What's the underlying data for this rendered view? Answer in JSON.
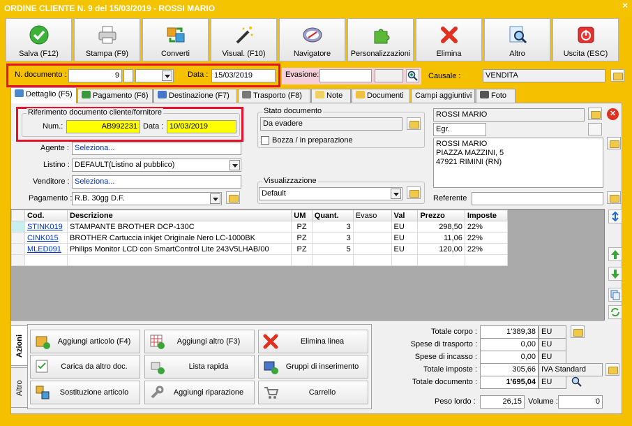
{
  "window": {
    "title": "ORDINE CLIENTE N. 9 del 15/03/2019 - ROSSI MARIO",
    "close": "×"
  },
  "toolbar": [
    {
      "label": "Salva (F12)",
      "icon": "check-icon"
    },
    {
      "label": "Stampa (F9)",
      "icon": "printer-icon"
    },
    {
      "label": "Converti",
      "icon": "convert-icon"
    },
    {
      "label": "Visual. (F10)",
      "icon": "wand-icon"
    },
    {
      "label": "Navigatore",
      "icon": "compass-icon"
    },
    {
      "label": "Personalizzazioni",
      "icon": "puzzle-icon"
    },
    {
      "label": "Elimina",
      "icon": "delete-x-icon"
    },
    {
      "label": "Altro",
      "icon": "magnifier-icon"
    },
    {
      "label": "Uscita (ESC)",
      "icon": "power-icon"
    }
  ],
  "header": {
    "ndoc_label": "N. documento :",
    "ndoc_value": "9",
    "data_label": "Data :",
    "data_value": "15/03/2019",
    "evasione_label": "Evasione:",
    "causale_label": "Causale :",
    "causale_value": "VENDITA"
  },
  "tabs": [
    "Dettaglio (F5)",
    "Pagamento (F6)",
    "Destinazione (F7)",
    "Trasporto (F8)",
    "Note",
    "Documenti",
    "Campi aggiuntivi",
    "Foto"
  ],
  "rif": {
    "title": "Riferimento documento cliente/fornitore",
    "num_label": "Num.:",
    "num_value": "AB992231",
    "data_label": "Data :",
    "data_value": "10/03/2019"
  },
  "stato": {
    "title": "Stato documento",
    "value": "Da evadere",
    "bozza": "Bozza / in preparazione"
  },
  "fields": {
    "agente_label": "Agente :",
    "agente_value": "Seleziona...",
    "listino_label": "Listino :",
    "listino_value": "DEFAULT(Listino al pubblico)",
    "venditore_label": "Venditore :",
    "venditore_value": "Seleziona...",
    "pagamento_label": "Pagamento :",
    "pagamento_value": "R.B. 30gg D.F."
  },
  "visual": {
    "title": "Visualizzazione",
    "value": "Default"
  },
  "cliente": {
    "name": "ROSSI MARIO",
    "title": "Egr.",
    "address": [
      "ROSSI MARIO",
      "PIAZZA MAZZINI, 5",
      "47921 RIMINI (RN)"
    ],
    "referente_label": "Referente"
  },
  "grid": {
    "headers": [
      "Cod.",
      "Descrizione",
      "UM",
      "Quant.",
      "Evaso",
      "Val",
      "Prezzo",
      "Imposte"
    ],
    "rows": [
      [
        "STINK019",
        "STAMPANTE BROTHER DCP-130C",
        "PZ",
        "3",
        "",
        "EU",
        "298,50",
        "22%"
      ],
      [
        "CINK015",
        "BROTHER Cartuccia inkjet Originale Nero LC-1000BK",
        "PZ",
        "3",
        "",
        "EU",
        "11,06",
        "22%"
      ],
      [
        "MLED091",
        "Philips Monitor LCD con SmartControl Lite 243V5LHAB/00",
        "PZ",
        "5",
        "",
        "EU",
        "120,00",
        "22%"
      ]
    ]
  },
  "side_tabs": [
    "Azioni",
    "Altro"
  ],
  "actions": [
    "Aggiungi articolo (F4)",
    "Aggiungi altro (F3)",
    "Elimina linea",
    "Carica da altro doc.",
    "Lista rapida",
    "Gruppi di inserimento",
    "Sostituzione articolo",
    "Aggiungi riparazione",
    "Carrello"
  ],
  "totals": [
    {
      "label": "Totale corpo :",
      "value": "1'389,38",
      "unit": "EU"
    },
    {
      "label": "Spese di trasporto :",
      "value": "0,00",
      "unit": "EU"
    },
    {
      "label": "Spese di incasso :",
      "value": "0,00",
      "unit": "EU"
    },
    {
      "label": "Totale imposte :",
      "value": "305,66",
      "unit": "IVA Standard"
    },
    {
      "label": "Totale documento :",
      "value": "1'695,04",
      "unit": "EU"
    }
  ],
  "peso": {
    "label": "Peso lordo :",
    "value": "26,15",
    "volume_label": "Volume :",
    "volume_value": "0"
  }
}
